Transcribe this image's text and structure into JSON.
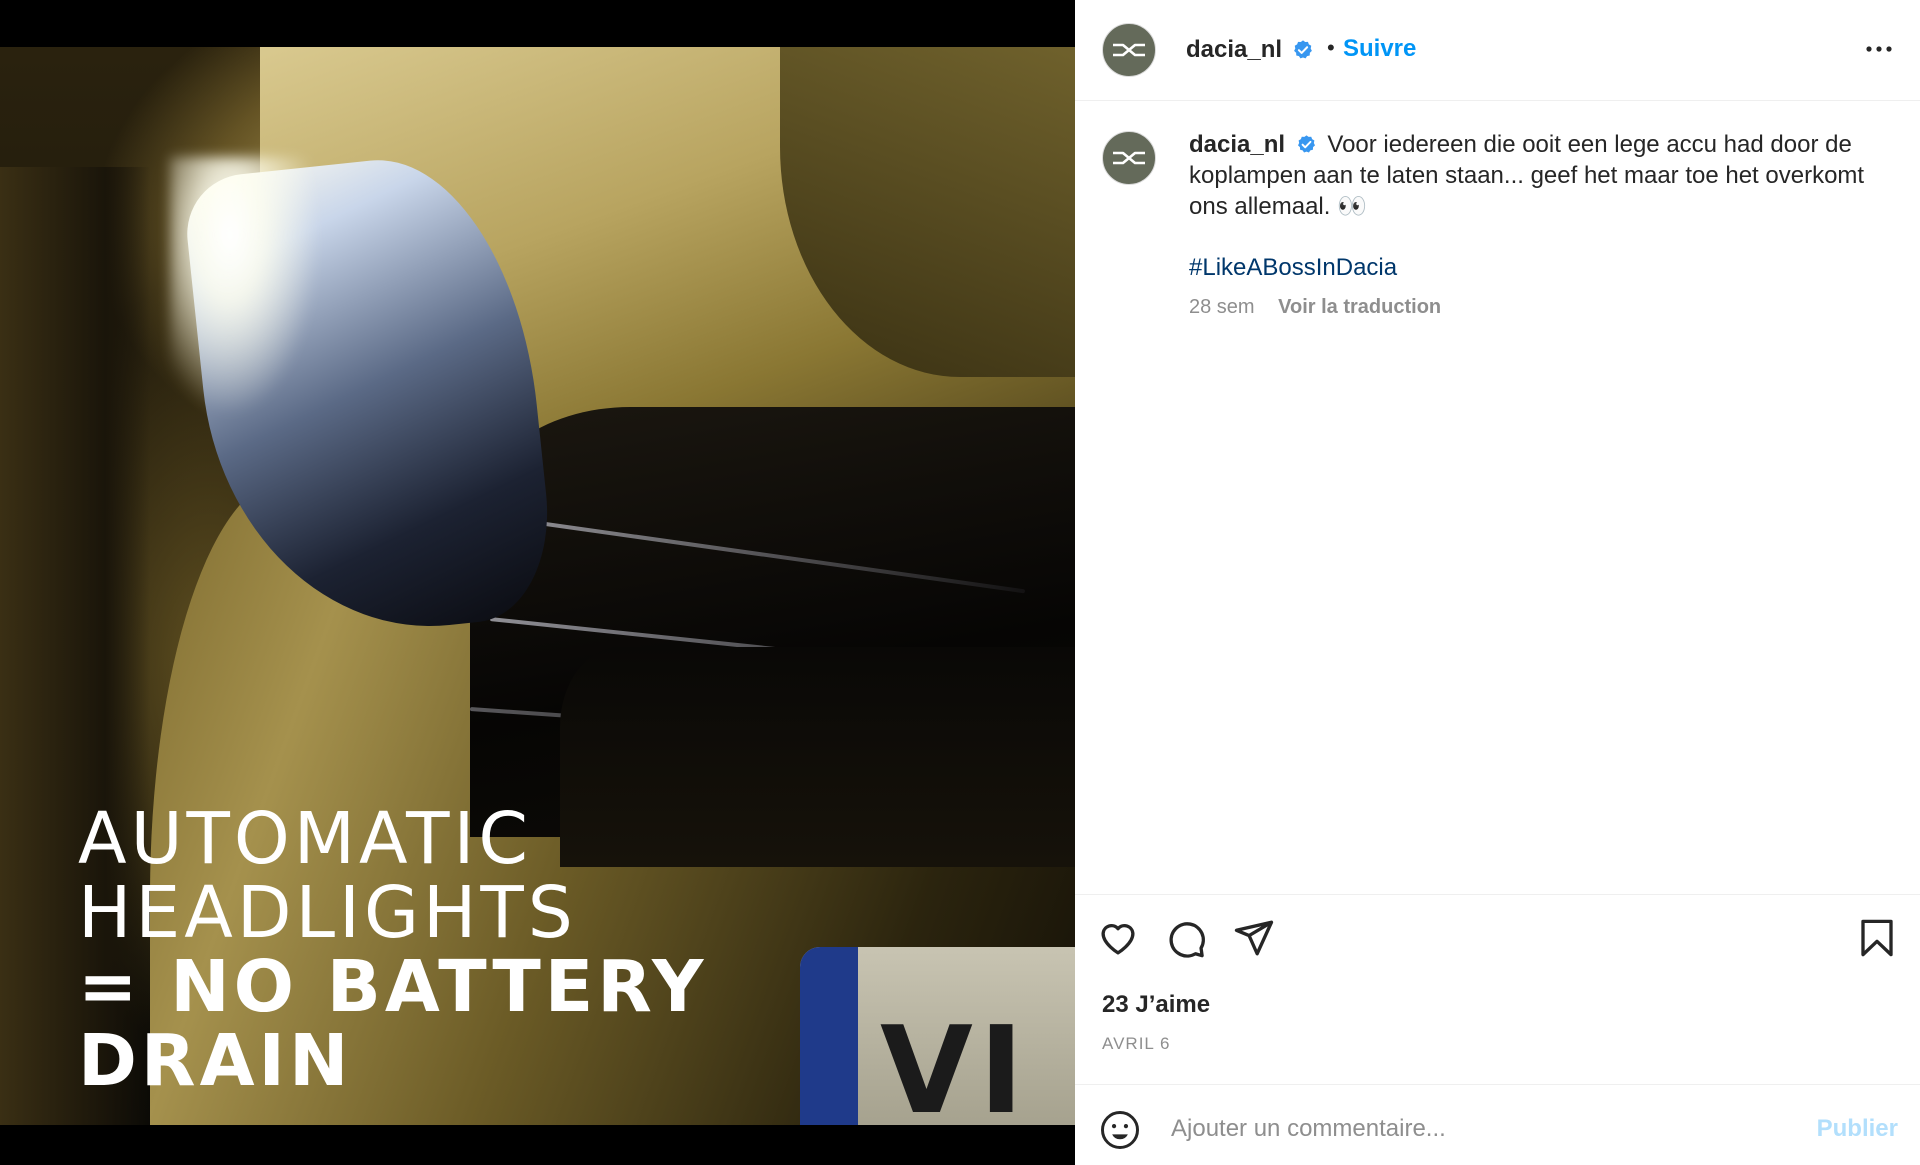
{
  "post_image": {
    "headline_lines": [
      "AUTOMATIC",
      "HEADLIGHTS",
      "= NO BATTERY",
      "DRAIN"
    ],
    "plate_text": "VI"
  },
  "header": {
    "username": "dacia_nl",
    "separator": "•",
    "follow_label": "Suivre",
    "avatar_icon": "dacia-logo-icon",
    "verified_icon": "verified-badge-icon",
    "more_icon": "more-options-icon"
  },
  "caption": {
    "username": "dacia_nl",
    "text": "Voor iedereen die ooit een lege accu had door de koplampen aan te laten staan... geef het maar toe het overkomt ons allemaal. 👀",
    "hashtag": "#LikeABossInDacia",
    "time_ago": "28 sem",
    "translate_label": "Voir la traduction"
  },
  "actions": {
    "like_icon": "heart-icon",
    "comment_icon": "comment-icon",
    "share_icon": "send-icon",
    "save_icon": "bookmark-icon",
    "likes_text": "23 J’aime",
    "date_text": "AVRIL 6"
  },
  "comment": {
    "emoji_icon": "emoji-icon",
    "placeholder": "Ajouter un commentaire...",
    "value": "",
    "publish_label": "Publier"
  },
  "colors": {
    "accent": "#0095f6",
    "avatar_bg": "#646a5a",
    "hashtag": "#00376b",
    "muted": "#8e8e8e",
    "publish_disabled": "#b2dffc"
  }
}
